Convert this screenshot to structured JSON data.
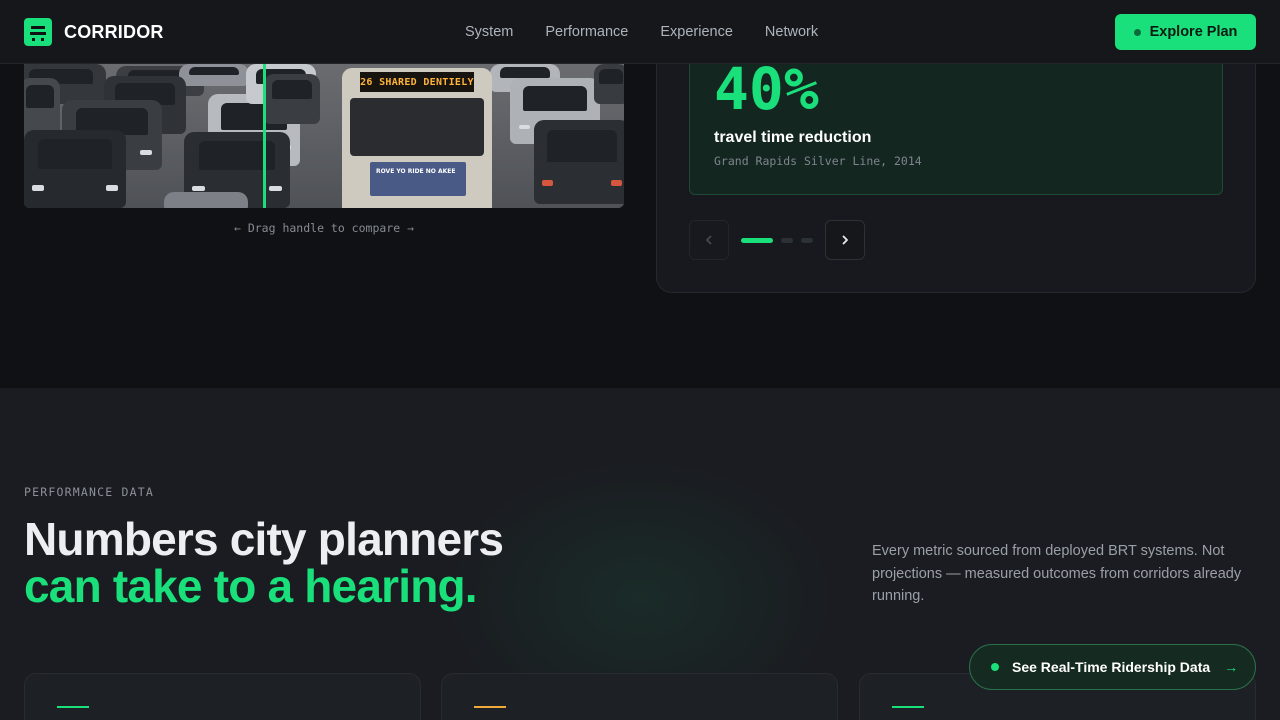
{
  "nav": {
    "brand": "CORRIDOR",
    "links": [
      "System",
      "Performance",
      "Experience",
      "Network"
    ],
    "cta_label": "Explore Plan"
  },
  "compare": {
    "bus_sign": "26 SHARED DENTIELY",
    "bus_ad": "ROVE YO RIDE NO AKEE",
    "caption": "← Drag handle to compare →"
  },
  "stat": {
    "value": "40%",
    "label": "travel time reduction",
    "source": "Grand Rapids Silver Line, 2014",
    "active_slide": 1,
    "slide_count": 3
  },
  "performance": {
    "eyebrow": "PERFORMANCE DATA",
    "headline_line1": "Numbers city planners",
    "headline_line2": "can take to a hearing.",
    "intro": "Every metric sourced from deployed BRT systems. Not projections — measured outcomes from corridors already running."
  },
  "metric_cards": [
    {
      "accent_color": "#19e07a"
    },
    {
      "accent_color": "#f0a93b"
    },
    {
      "accent_color": "#19e07a"
    }
  ],
  "floating_cta": {
    "label": "See Real-Time Ridership Data",
    "arrow": "→"
  },
  "colors": {
    "accent": "#19e07a",
    "background": "#0f1115",
    "section_bg": "#1a1c21",
    "warning": "#f0a93b"
  }
}
